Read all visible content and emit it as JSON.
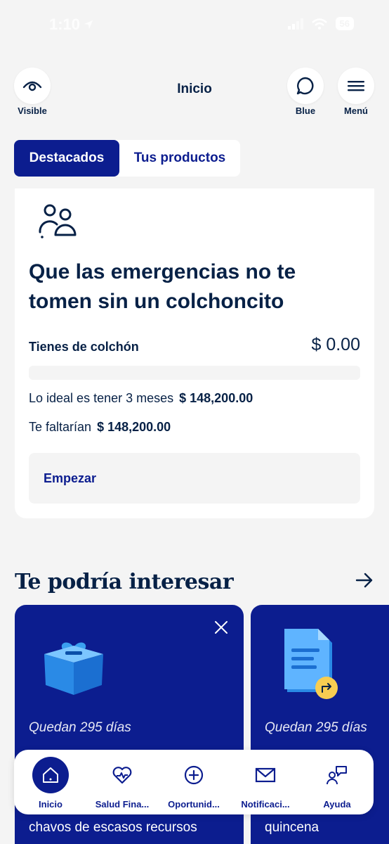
{
  "status_bar": {
    "time": "1:10",
    "battery": "56"
  },
  "header": {
    "title": "Inicio",
    "visible_label": "Visible",
    "blue_label": "Blue",
    "menu_label": "Menú"
  },
  "tabs": [
    {
      "label": "Destacados",
      "active": true
    },
    {
      "label": "Tus productos",
      "active": false
    }
  ],
  "savings_card": {
    "title": "Que las emergencias no te tomen sin un colchoncito",
    "cushion_label": "Tienes de colchón",
    "cushion_amount": "$ 0.00",
    "progress": 0,
    "ideal_label": "Lo ideal es tener 3 meses",
    "ideal_amount": "$ 148,200.00",
    "missing_label": "Te faltarían",
    "missing_amount": "$ 148,200.00",
    "start_button": "Empezar"
  },
  "interest_section": {
    "title": "Te podría interesar",
    "cards": [
      {
        "days": "Quedan 295 días",
        "text": "chavos de escasos recursos"
      },
      {
        "days": "Quedan 295 días",
        "text": "quincena"
      }
    ]
  },
  "bottom_nav": [
    {
      "label": "Inicio",
      "icon": "home-icon"
    },
    {
      "label": "Salud Fina...",
      "icon": "heart-pulse-icon"
    },
    {
      "label": "Oportunid...",
      "icon": "plus-circle-icon"
    },
    {
      "label": "Notificaci...",
      "icon": "mail-icon"
    },
    {
      "label": "Ayuda",
      "icon": "help-chat-icon"
    }
  ],
  "colors": {
    "brand": "#0c1d8f",
    "text": "#072146",
    "background": "#f4f4f4",
    "accent": "#f8cd51"
  }
}
